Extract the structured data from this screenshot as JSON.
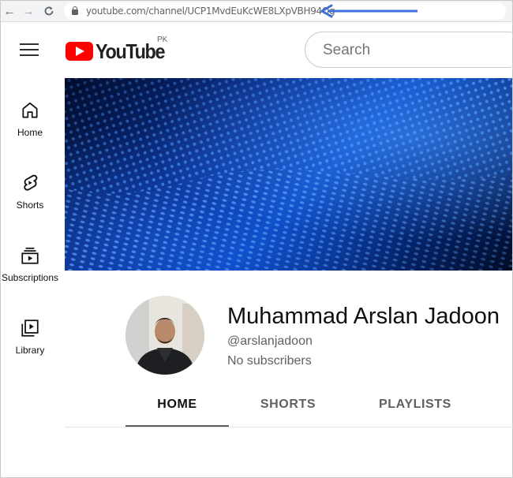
{
  "browser": {
    "url": "youtube.com/channel/UCP1MvdEuKcWE8LXpVBH94Og"
  },
  "masthead": {
    "logo_text": "YouTube",
    "country_code": "PK",
    "search_placeholder": "Search"
  },
  "sidebar": {
    "items": [
      {
        "label": "Home",
        "icon": "home-icon"
      },
      {
        "label": "Shorts",
        "icon": "shorts-icon"
      },
      {
        "label": "Subscriptions",
        "icon": "subscriptions-icon"
      },
      {
        "label": "Library",
        "icon": "library-icon"
      }
    ]
  },
  "channel": {
    "name": "Muhammad Arslan Jadoon",
    "handle": "@arslanjadoon",
    "subscribers": "No subscribers"
  },
  "tabs": [
    {
      "label": "HOME",
      "active": true
    },
    {
      "label": "SHORTS",
      "active": false
    },
    {
      "label": "PLAYLISTS",
      "active": false
    }
  ],
  "colors": {
    "brand_red": "#ff0000",
    "annotation_arrow": "#3f6fd8",
    "banner_blue": "#0b49c2"
  }
}
